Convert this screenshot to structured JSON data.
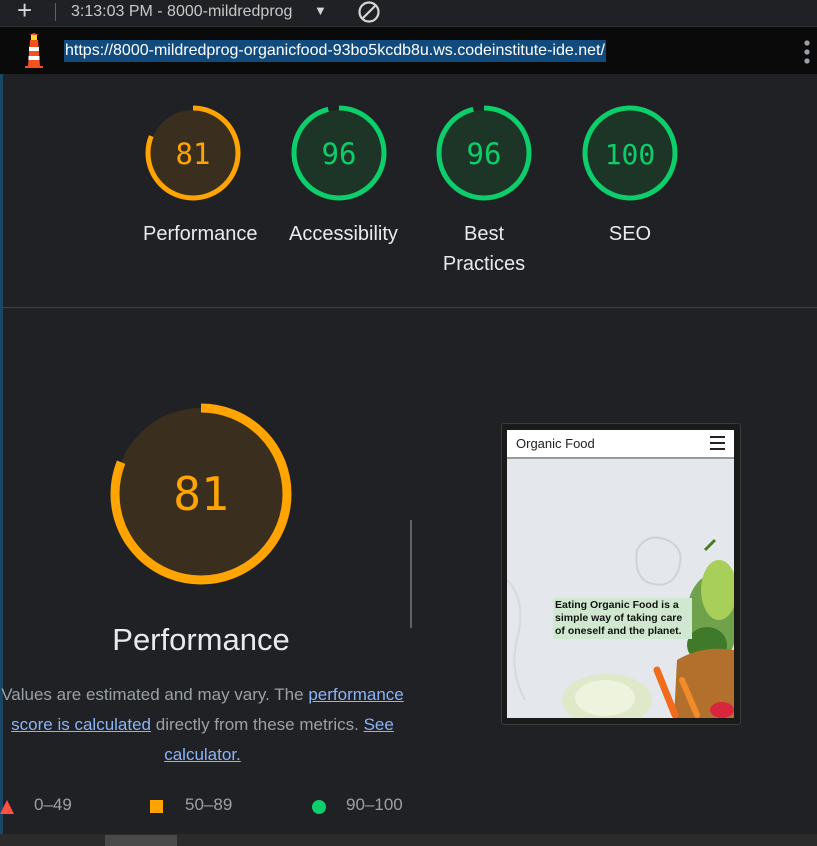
{
  "topbar": {
    "title": "3:13:03 PM - 8000-mildredprog",
    "icons": [
      "plus-icon",
      "chevron-down-icon",
      "block-icon"
    ]
  },
  "urlbar": {
    "url": "https://8000-mildredprog-organicfood-93bo5kcdb8u.ws.codeinstitute-ide.net/",
    "icons": [
      "lighthouse-icon",
      "more-vert-icon"
    ]
  },
  "colors": {
    "orange": "#ffa400",
    "green": "#0cce6b",
    "red": "#ff4e42",
    "link": "#8ab4f8"
  },
  "scores": [
    {
      "label": "Performance",
      "score": "81",
      "value": 81,
      "color": "#ffa400"
    },
    {
      "label": "Accessibility",
      "score": "96",
      "value": 96,
      "color": "#0cce6b"
    },
    {
      "label": "Best Practices",
      "score": "96",
      "value": 96,
      "color": "#0cce6b"
    },
    {
      "label": "SEO",
      "score": "100",
      "value": 100,
      "color": "#0cce6b"
    }
  ],
  "main": {
    "score": "81",
    "value": 81,
    "title": "Performance",
    "desc_pre": "Values are estimated and may vary. The ",
    "desc_link": "performance score is calculated",
    "desc_mid": " directly from these metrics. ",
    "desc_link2": "See calculator."
  },
  "legend": {
    "fail": "0–49",
    "average": "50–89",
    "pass": "90–100"
  },
  "screenshot": {
    "brand": "Organic Food",
    "hero": "Eating Organic Food is a simple way of taking care of oneself and the planet."
  }
}
